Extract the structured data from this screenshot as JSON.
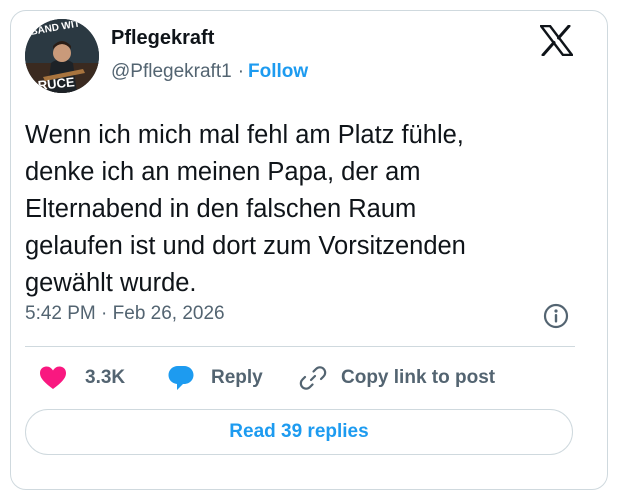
{
  "author": {
    "name": "Pflegekraft",
    "handle": "@Pflegekraft1",
    "separator": "·",
    "follow_label": "Follow",
    "avatar_text_top": "BAND WIT",
    "avatar_text_bottom": "BRUCE"
  },
  "tweet": {
    "lines": [
      "Wenn ich mich mal fehl am Platz fühle,",
      "denke ich an meinen Papa, der am",
      "Elternabend in den falschen Raum",
      "gelaufen ist und dort zum Vorsitzenden",
      "gewählt wurde."
    ],
    "timestamp": "5:42 PM · Feb 26, 2026"
  },
  "actions": {
    "likes_count": "3.3K",
    "reply_label": "Reply",
    "copy_link_label": "Copy link to post"
  },
  "footer": {
    "read_replies_label": "Read 39 replies"
  },
  "icons": {
    "platform": "x-logo-icon",
    "info": "info-icon",
    "like": "heart-icon",
    "reply": "speech-bubble-icon",
    "copy": "link-icon"
  },
  "colors": {
    "accent": "#1d9bf0",
    "like": "#f91880",
    "text": "#0f1419",
    "secondary": "#536471",
    "border": "#cfd9de"
  }
}
